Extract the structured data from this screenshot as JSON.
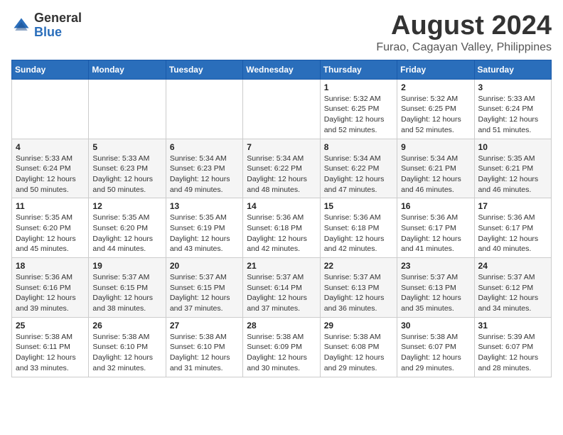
{
  "header": {
    "logo_general": "General",
    "logo_blue": "Blue",
    "title": "August 2024",
    "location": "Furao, Cagayan Valley, Philippines"
  },
  "calendar": {
    "weekdays": [
      "Sunday",
      "Monday",
      "Tuesday",
      "Wednesday",
      "Thursday",
      "Friday",
      "Saturday"
    ],
    "weeks": [
      [
        {
          "day": "",
          "info": ""
        },
        {
          "day": "",
          "info": ""
        },
        {
          "day": "",
          "info": ""
        },
        {
          "day": "",
          "info": ""
        },
        {
          "day": "1",
          "info": "Sunrise: 5:32 AM\nSunset: 6:25 PM\nDaylight: 12 hours\nand 52 minutes."
        },
        {
          "day": "2",
          "info": "Sunrise: 5:32 AM\nSunset: 6:25 PM\nDaylight: 12 hours\nand 52 minutes."
        },
        {
          "day": "3",
          "info": "Sunrise: 5:33 AM\nSunset: 6:24 PM\nDaylight: 12 hours\nand 51 minutes."
        }
      ],
      [
        {
          "day": "4",
          "info": "Sunrise: 5:33 AM\nSunset: 6:24 PM\nDaylight: 12 hours\nand 50 minutes."
        },
        {
          "day": "5",
          "info": "Sunrise: 5:33 AM\nSunset: 6:23 PM\nDaylight: 12 hours\nand 50 minutes."
        },
        {
          "day": "6",
          "info": "Sunrise: 5:34 AM\nSunset: 6:23 PM\nDaylight: 12 hours\nand 49 minutes."
        },
        {
          "day": "7",
          "info": "Sunrise: 5:34 AM\nSunset: 6:22 PM\nDaylight: 12 hours\nand 48 minutes."
        },
        {
          "day": "8",
          "info": "Sunrise: 5:34 AM\nSunset: 6:22 PM\nDaylight: 12 hours\nand 47 minutes."
        },
        {
          "day": "9",
          "info": "Sunrise: 5:34 AM\nSunset: 6:21 PM\nDaylight: 12 hours\nand 46 minutes."
        },
        {
          "day": "10",
          "info": "Sunrise: 5:35 AM\nSunset: 6:21 PM\nDaylight: 12 hours\nand 46 minutes."
        }
      ],
      [
        {
          "day": "11",
          "info": "Sunrise: 5:35 AM\nSunset: 6:20 PM\nDaylight: 12 hours\nand 45 minutes."
        },
        {
          "day": "12",
          "info": "Sunrise: 5:35 AM\nSunset: 6:20 PM\nDaylight: 12 hours\nand 44 minutes."
        },
        {
          "day": "13",
          "info": "Sunrise: 5:35 AM\nSunset: 6:19 PM\nDaylight: 12 hours\nand 43 minutes."
        },
        {
          "day": "14",
          "info": "Sunrise: 5:36 AM\nSunset: 6:18 PM\nDaylight: 12 hours\nand 42 minutes."
        },
        {
          "day": "15",
          "info": "Sunrise: 5:36 AM\nSunset: 6:18 PM\nDaylight: 12 hours\nand 42 minutes."
        },
        {
          "day": "16",
          "info": "Sunrise: 5:36 AM\nSunset: 6:17 PM\nDaylight: 12 hours\nand 41 minutes."
        },
        {
          "day": "17",
          "info": "Sunrise: 5:36 AM\nSunset: 6:17 PM\nDaylight: 12 hours\nand 40 minutes."
        }
      ],
      [
        {
          "day": "18",
          "info": "Sunrise: 5:36 AM\nSunset: 6:16 PM\nDaylight: 12 hours\nand 39 minutes."
        },
        {
          "day": "19",
          "info": "Sunrise: 5:37 AM\nSunset: 6:15 PM\nDaylight: 12 hours\nand 38 minutes."
        },
        {
          "day": "20",
          "info": "Sunrise: 5:37 AM\nSunset: 6:15 PM\nDaylight: 12 hours\nand 37 minutes."
        },
        {
          "day": "21",
          "info": "Sunrise: 5:37 AM\nSunset: 6:14 PM\nDaylight: 12 hours\nand 37 minutes."
        },
        {
          "day": "22",
          "info": "Sunrise: 5:37 AM\nSunset: 6:13 PM\nDaylight: 12 hours\nand 36 minutes."
        },
        {
          "day": "23",
          "info": "Sunrise: 5:37 AM\nSunset: 6:13 PM\nDaylight: 12 hours\nand 35 minutes."
        },
        {
          "day": "24",
          "info": "Sunrise: 5:37 AM\nSunset: 6:12 PM\nDaylight: 12 hours\nand 34 minutes."
        }
      ],
      [
        {
          "day": "25",
          "info": "Sunrise: 5:38 AM\nSunset: 6:11 PM\nDaylight: 12 hours\nand 33 minutes."
        },
        {
          "day": "26",
          "info": "Sunrise: 5:38 AM\nSunset: 6:10 PM\nDaylight: 12 hours\nand 32 minutes."
        },
        {
          "day": "27",
          "info": "Sunrise: 5:38 AM\nSunset: 6:10 PM\nDaylight: 12 hours\nand 31 minutes."
        },
        {
          "day": "28",
          "info": "Sunrise: 5:38 AM\nSunset: 6:09 PM\nDaylight: 12 hours\nand 30 minutes."
        },
        {
          "day": "29",
          "info": "Sunrise: 5:38 AM\nSunset: 6:08 PM\nDaylight: 12 hours\nand 29 minutes."
        },
        {
          "day": "30",
          "info": "Sunrise: 5:38 AM\nSunset: 6:07 PM\nDaylight: 12 hours\nand 29 minutes."
        },
        {
          "day": "31",
          "info": "Sunrise: 5:39 AM\nSunset: 6:07 PM\nDaylight: 12 hours\nand 28 minutes."
        }
      ]
    ]
  }
}
